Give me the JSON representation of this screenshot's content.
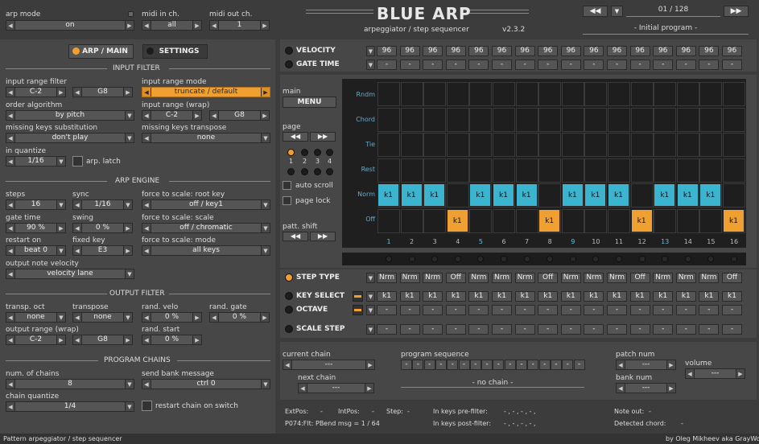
{
  "app": {
    "title": "BLUE ARP",
    "subtitle": "arpeggiator / step sequencer",
    "version": "v2.3.2",
    "program_counter": "01 / 128",
    "program_name": "- Initial program -",
    "footer_left": "Pattern arpeggiator / step sequencer",
    "footer_right": "by Oleg Mikheev aka GrayWolf"
  },
  "top": {
    "arp_mode_label": "arp mode",
    "arp_mode": "on",
    "midi_in_label": "midi in ch.",
    "midi_in": "all",
    "midi_out_label": "midi out ch.",
    "midi_out": "1"
  },
  "tabs": {
    "arp_main": "ARP / MAIN",
    "settings": "SETTINGS"
  },
  "input_filter": {
    "title": "INPUT FILTER",
    "range_filter_label": "input range filter",
    "range_lo": "C-2",
    "range_hi": "G8",
    "range_mode_label": "input range mode",
    "range_mode": "truncate / default",
    "order_label": "order algorithm",
    "order": "by pitch",
    "range_wrap_label": "input range (wrap)",
    "wrap_lo": "C-2",
    "wrap_hi": "G8",
    "missing_sub_label": "missing keys substitution",
    "missing_sub": "don't play",
    "missing_tr_label": "missing keys transpose",
    "missing_tr": "none",
    "quantize_label": "in quantize",
    "quantize": "1/16",
    "arp_latch": "arp. latch"
  },
  "arp_engine": {
    "title": "ARP ENGINE",
    "steps_label": "steps",
    "steps": "16",
    "sync_label": "sync",
    "sync": "1/16",
    "root_label": "force to scale: root key",
    "root": "off / key1",
    "gate_label": "gate time",
    "gate": "90 %",
    "swing_label": "swing",
    "swing": "0 %",
    "scale_label": "force to scale: scale",
    "scale": "off / chromatic",
    "restart_label": "restart on",
    "restart": "beat 0",
    "fixed_label": "fixed key",
    "fixed": "E3",
    "mode_label": "force to scale: mode",
    "mode": "all keys",
    "velocity_label": "output note velocity",
    "velocity": "velocity lane"
  },
  "output_filter": {
    "title": "OUTPUT FILTER",
    "oct_label": "transp. oct",
    "oct": "none",
    "transpose_label": "transpose",
    "transpose": "none",
    "rvelo_label": "rand. velo",
    "rvelo": "0 %",
    "rgate_label": "rand. gate",
    "rgate": "0 %",
    "range_label": "output range (wrap)",
    "out_lo": "C-2",
    "out_hi": "G8",
    "rstart_label": "rand. start",
    "rstart": "0 %"
  },
  "chains": {
    "title": "PROGRAM CHAINS",
    "num_label": "num. of chains",
    "num": "8",
    "bank_label": "send bank message",
    "bank": "ctrl 0",
    "quant_label": "chain quantize",
    "quant": "1/4",
    "restart": "restart chain on switch"
  },
  "lanes": {
    "velocity": "VELOCITY",
    "gate": "GATE TIME",
    "velocity_values": [
      "96",
      "96",
      "96",
      "96",
      "96",
      "96",
      "96",
      "96",
      "96",
      "96",
      "96",
      "96",
      "96",
      "96",
      "96",
      "96"
    ],
    "gate_values": [
      "-",
      "-",
      "-",
      "-",
      "-",
      "-",
      "-",
      "-",
      "-",
      "-",
      "-",
      "-",
      "-",
      "-",
      "-",
      "-"
    ]
  },
  "side": {
    "main": "main",
    "menu": "MENU",
    "page": "page",
    "page_nums": [
      "1",
      "2",
      "3",
      "4"
    ],
    "auto_scroll": "auto scroll",
    "page_lock": "page lock",
    "patt_shift": "patt. shift"
  },
  "grid": {
    "rows": [
      "Rndm",
      "Chord",
      "Tie",
      "Rest",
      "Norm",
      "Off"
    ],
    "steps": [
      "1",
      "2",
      "3",
      "4",
      "5",
      "6",
      "7",
      "8",
      "9",
      "10",
      "11",
      "12",
      "13",
      "14",
      "15",
      "16"
    ],
    "key": "k1"
  },
  "step_type": {
    "label": "STEP TYPE",
    "values": [
      "Nrm",
      "Nrm",
      "Nrm",
      "Off",
      "Nrm",
      "Nrm",
      "Nrm",
      "Off",
      "Nrm",
      "Nrm",
      "Nrm",
      "Off",
      "Nrm",
      "Nrm",
      "Nrm",
      "Off"
    ]
  },
  "key_select": {
    "label": "KEY SELECT",
    "values": [
      "k1",
      "k1",
      "k1",
      "k1",
      "k1",
      "k1",
      "k1",
      "k1",
      "k1",
      "k1",
      "k1",
      "k1",
      "k1",
      "k1",
      "k1",
      "k1"
    ]
  },
  "octave": {
    "label": "OCTAVE",
    "values": [
      "-",
      "-",
      "-",
      "-",
      "-",
      "-",
      "-",
      "-",
      "-",
      "-",
      "-",
      "-",
      "-",
      "-",
      "-",
      "-"
    ]
  },
  "scale_step": {
    "label": "SCALE STEP",
    "values": [
      "-",
      "-",
      "-",
      "-",
      "-",
      "-",
      "-",
      "-",
      "-",
      "-",
      "-",
      "-",
      "-",
      "-",
      "-",
      "-"
    ]
  },
  "chain_area": {
    "current_label": "current chain",
    "current": "---",
    "next_label": "next chain",
    "next": "---",
    "seq_label": "program sequence",
    "seq_values": [
      "-",
      "-",
      "-",
      "-",
      "-",
      "-",
      "-",
      "-",
      "-",
      "-",
      "-",
      "-",
      "-",
      "-",
      "-",
      "-"
    ],
    "no_chain": "- no chain -",
    "patch_label": "patch num",
    "patch": "---",
    "bank_label": "bank num",
    "bank": "---",
    "volume_label": "volume",
    "volume": "---"
  },
  "status": {
    "extpos": "ExtPos:",
    "extpos_v": "-",
    "intpos": "IntPos:",
    "intpos_v": "-",
    "step": "Step:",
    "step_v": "-",
    "pre": "In keys pre-filter:",
    "pre_v": "- , - , - , - ,",
    "post": "In keys post-filter:",
    "post_v": "- , - , - , - ,",
    "noteout": "Note out:",
    "noteout_v": "-",
    "chord": "Detected chord:",
    "chord_v": "-",
    "msg": "P074:Flt: PBend msg = 1 / 64"
  },
  "colors": {
    "accent": "#f0a030",
    "cyan": "#3bb4d0"
  }
}
